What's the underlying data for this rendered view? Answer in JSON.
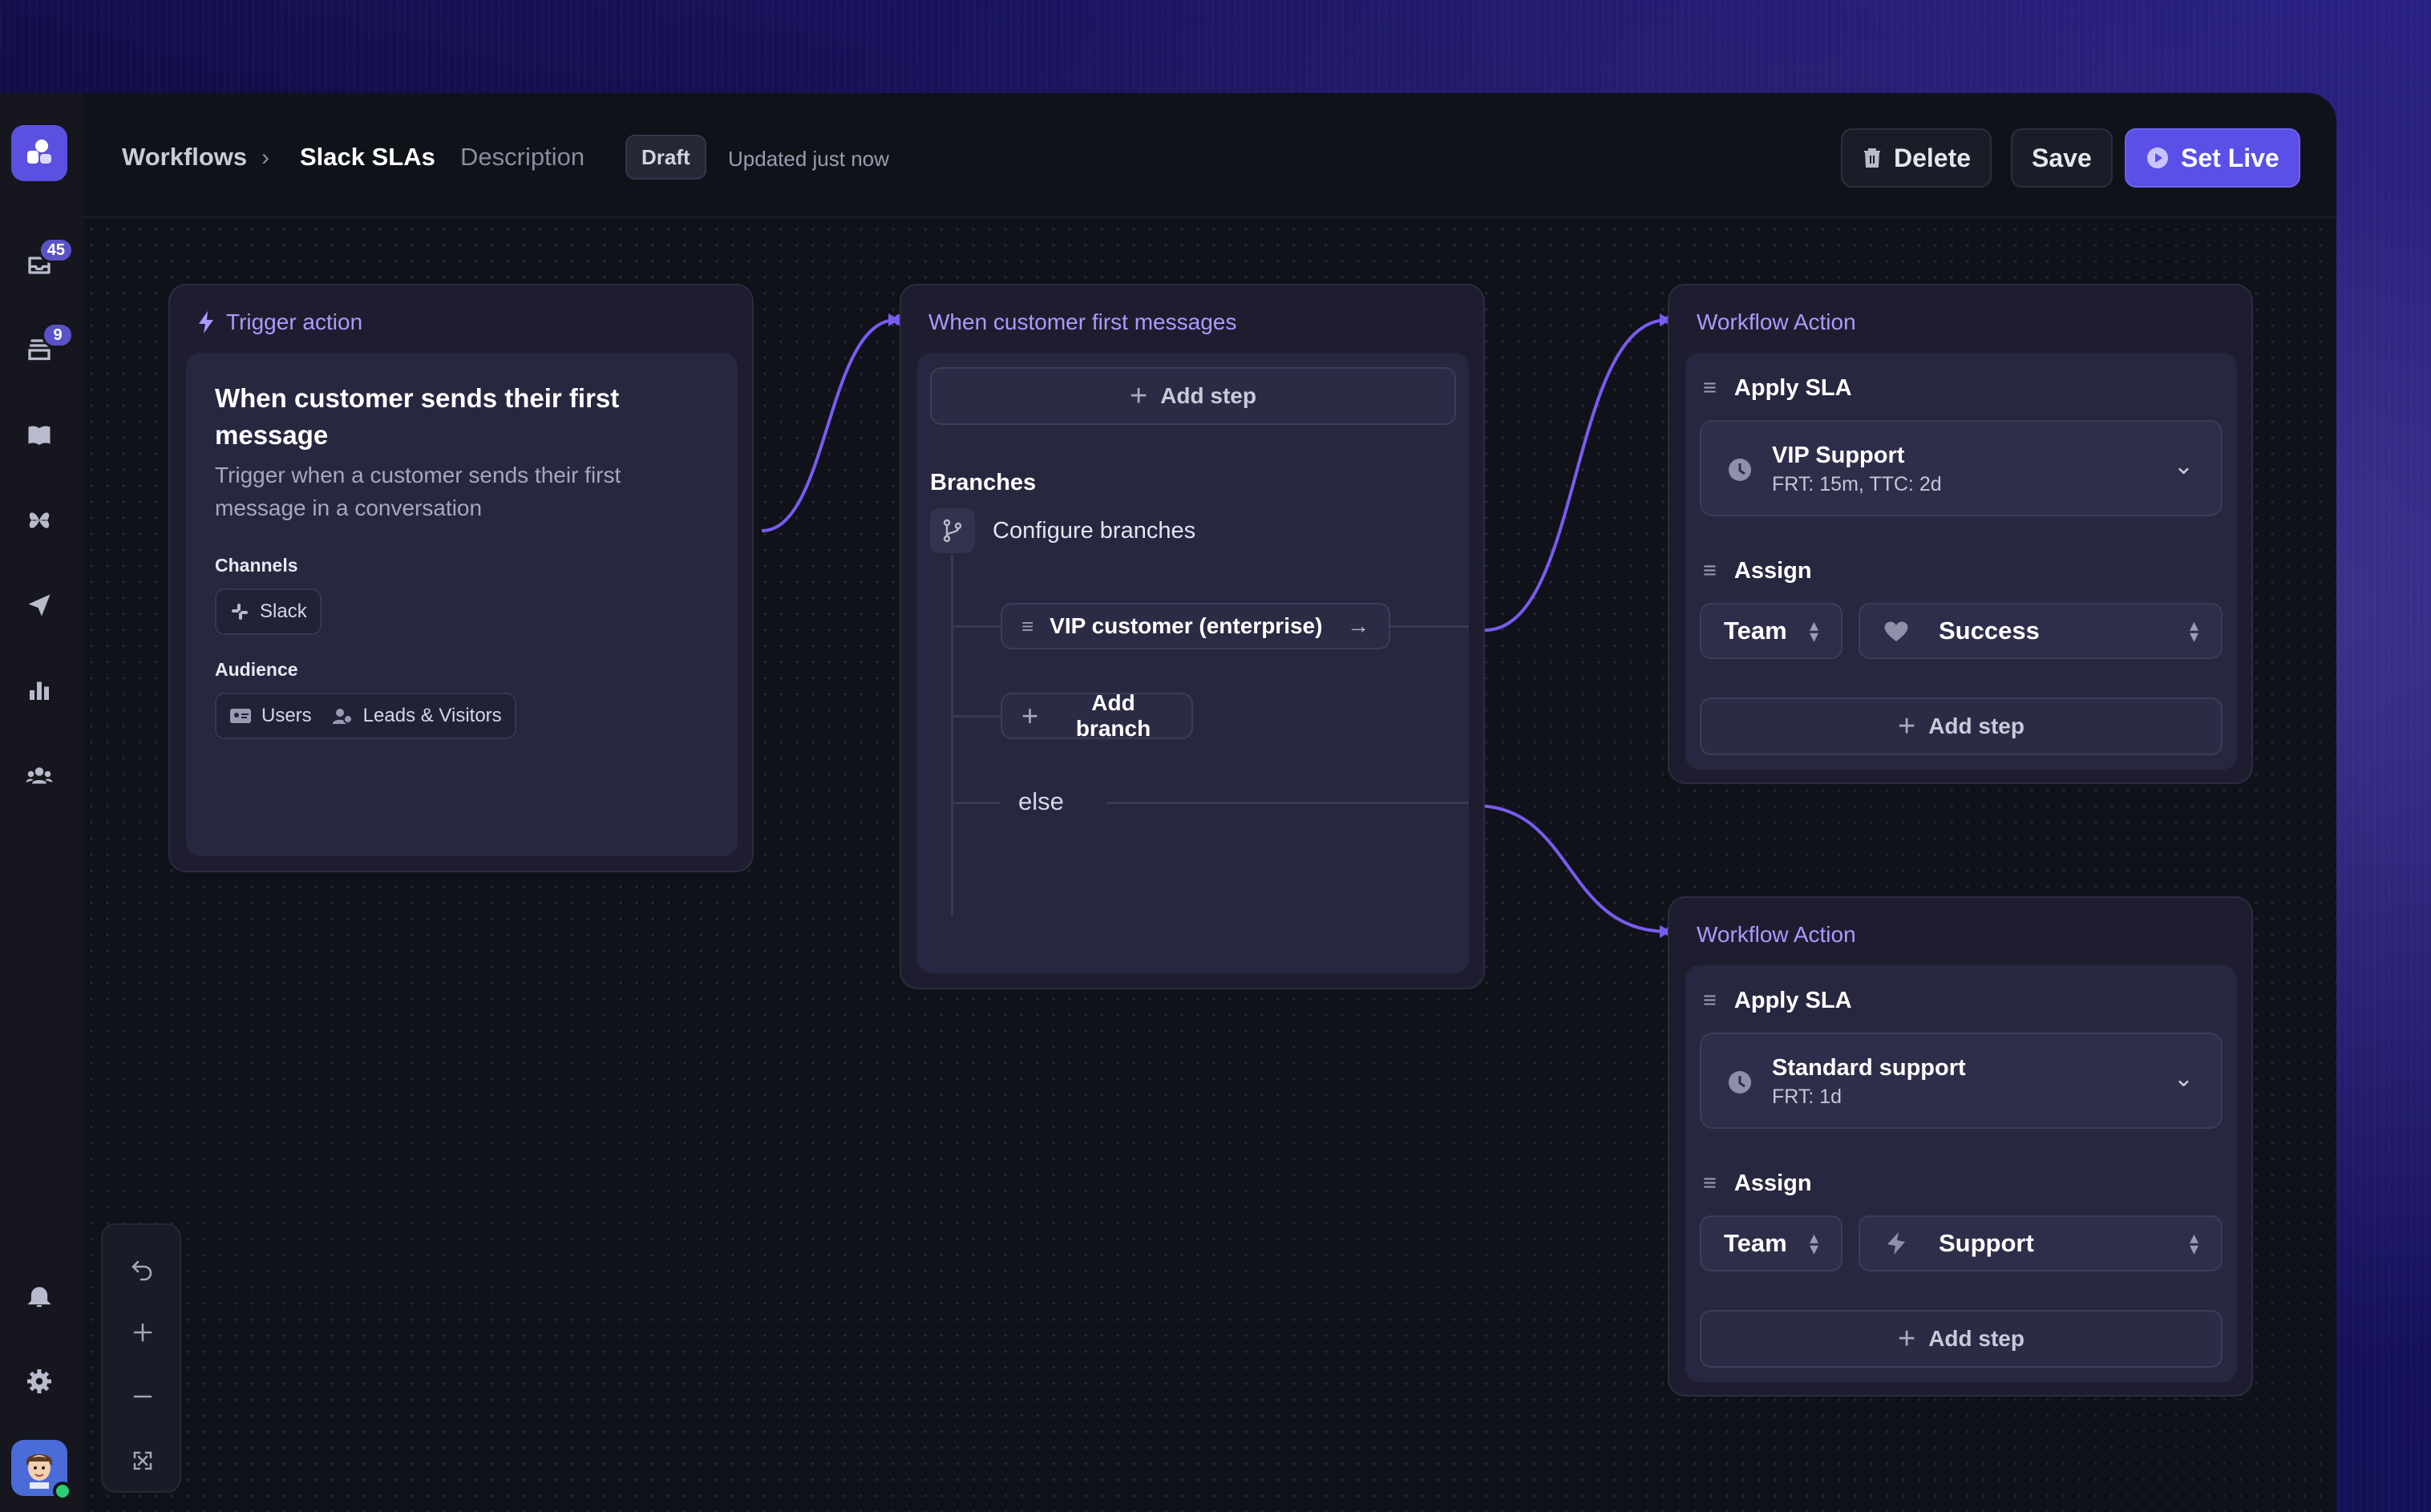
{
  "header": {
    "breadcrumb_root": "Workflows",
    "workflow_name": "Slack SLAs",
    "description_link": "Description",
    "status_chip": "Draft",
    "updated_text": "Updated just now",
    "delete_label": "Delete",
    "save_label": "Save",
    "setlive_label": "Set Live"
  },
  "sidebar": {
    "items": [
      {
        "icon": "inbox-icon",
        "badge": "45"
      },
      {
        "icon": "tray-icon",
        "badge": "9"
      },
      {
        "icon": "book-icon"
      },
      {
        "icon": "apps-icon"
      },
      {
        "icon": "send-icon"
      },
      {
        "icon": "reports-icon"
      },
      {
        "icon": "contacts-icon"
      }
    ],
    "bottom": [
      "bell-icon",
      "gear-icon",
      "avatar"
    ]
  },
  "trigger_node": {
    "header": "Trigger action",
    "title": "When customer sends their first message",
    "description": "Trigger when a customer sends their first message in a conversation",
    "channels_label": "Channels",
    "channel": "Slack",
    "audience_label": "Audience",
    "audience": [
      "Users",
      "Leads & Visitors"
    ]
  },
  "branch_node": {
    "header": "When customer first messages",
    "add_step": "Add step",
    "branches_label": "Branches",
    "configure_label": "Configure branches",
    "branch_1": "VIP customer (enterprise)",
    "add_branch": "Add branch",
    "else_label": "else"
  },
  "action_nodes": [
    {
      "header": "Workflow Action",
      "sla_label": "Apply SLA",
      "sla_name": "VIP Support",
      "sla_detail": "FRT: 15m, TTC: 2d",
      "assign_label": "Assign",
      "assign_type": "Team",
      "assign_value": "Success",
      "add_step": "Add step"
    },
    {
      "header": "Workflow Action",
      "sla_label": "Apply SLA",
      "sla_name": "Standard support",
      "sla_detail": "FRT: 1d",
      "assign_label": "Assign",
      "assign_type": "Team",
      "assign_value": "Support",
      "add_step": "Add step"
    }
  ],
  "colors": {
    "accent": "#5a4fe6",
    "node_header": "#a99bff",
    "wire": "#7a5cf0"
  }
}
